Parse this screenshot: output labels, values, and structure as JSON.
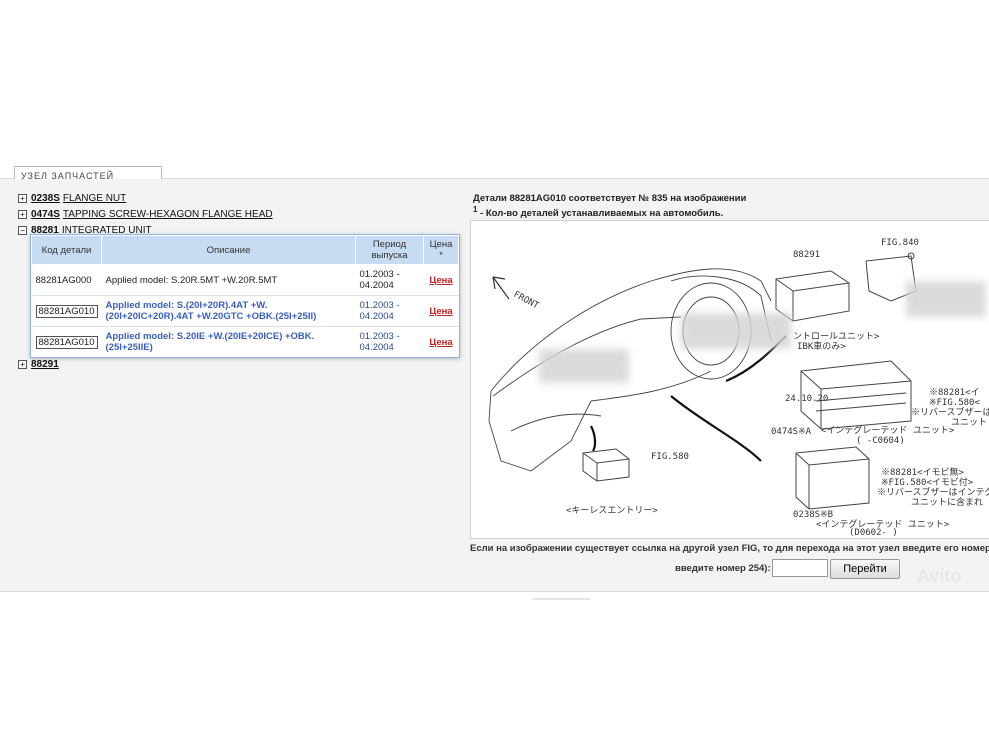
{
  "tab_label": "УЗЕЛ ЗАПЧАСТЕЙ",
  "tree": [
    {
      "code": "0238S",
      "name": "FLANGE NUT",
      "expander": "+"
    },
    {
      "code": "0474S",
      "name": "TAPPING SCREW-HEXAGON FLANGE HEAD",
      "expander": "+"
    },
    {
      "code": "88281",
      "name": "INTEGRATED UNIT",
      "expander": "−"
    }
  ],
  "tree_after": {
    "code": "88291",
    "name": "",
    "expander": "+"
  },
  "table": {
    "headers": [
      "Код детали",
      "Описание",
      "Период выпуска",
      "Цена *"
    ],
    "rows": [
      {
        "code": "88281AG000",
        "desc": "Applied model: S.20R.5MT +W.20R.5MT",
        "period": "01.2003 - 04.2004",
        "price": "Цена",
        "selected": false
      },
      {
        "code": "88281AG010",
        "desc": "Applied model: S.(20I+20R).4AT +W.(20I+20IC+20R).4AT +W.20GTC +OBK.(25I+25II)",
        "period": "01.2003 - 04.2004",
        "price": "Цена",
        "selected": true
      },
      {
        "code": "88281AG010",
        "desc": "Applied model: S.20IE +W.(20IE+20ICE) +OBK.(25I+25IIE)",
        "period": "01.2003 - 04.2004",
        "price": "Цена",
        "selected": true
      }
    ]
  },
  "right": {
    "line1": "Детали 88281AG010 соответствует № 835 на изображении",
    "line2_sup": "1",
    "line2": " - Кол-во деталей устанавливаемых на автомобиль."
  },
  "diagram": {
    "labels": {
      "front": "FRONT",
      "fig840": "FIG.840",
      "p88291": "88291",
      "fig580": "FIG.580",
      "keyless": "<キーレスエントリー>",
      "unit_a": "ントロールユニット>",
      "unit_a2": "IBK車のみ>",
      "l88281": "※88281<イ",
      "lfig580a": "※FIG.580<",
      "lbuzzer_a": "※リバースブザーは",
      "lunit_a": "ユニット",
      "p0474s": "0474S※A",
      "integrated_a": "<インテグレーテッド ユニット>",
      "c0604": "( -C0604)",
      "date": "24.10.20",
      "l88281b": "※88281<イモビ無>",
      "lfig580b": "※FIG.580<イモビ付>",
      "lbuzzer_b": "※リバースブザーはインテグ",
      "lunit_b": "ユニットに含まれ",
      "p0238s": "0238S※B",
      "integrated_b": "<インテグレーテッド ユニット>",
      "d0602": "(D0602- )"
    }
  },
  "note": "Если на изображении существует ссылка на другой узел FIG, то для перехода на этот узел введите его номер",
  "note2_label": "введите номер 254):",
  "input_value": "",
  "go_button": "Перейти",
  "watermark": "Avito"
}
